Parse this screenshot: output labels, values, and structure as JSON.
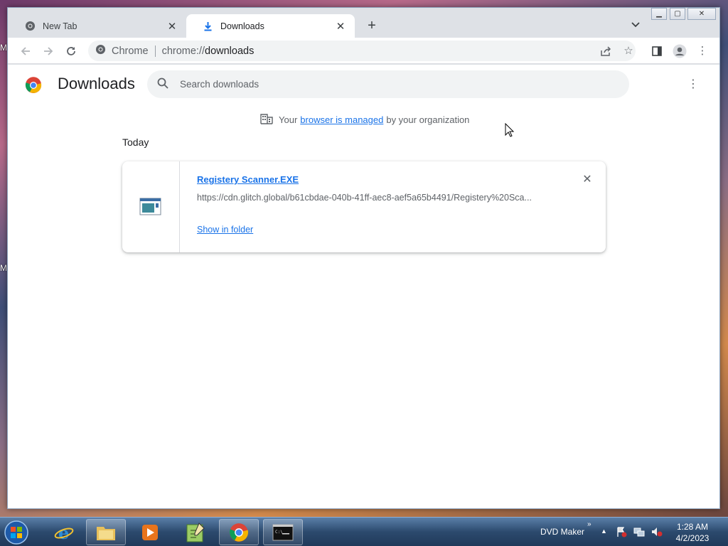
{
  "desktop": {
    "edge_labels": [
      "M",
      "M"
    ]
  },
  "browser": {
    "tabs": [
      {
        "label": "New Tab",
        "active": false
      },
      {
        "label": "Downloads",
        "active": true
      }
    ],
    "new_tab_symbol": "+",
    "close_symbol": "✕",
    "window_controls": {
      "minimize": "▁",
      "maximize": "▢",
      "close": "✕"
    },
    "omnibox": {
      "chip_label": "Chrome",
      "url_scheme": "chrome://",
      "url_host": "downloads"
    }
  },
  "page": {
    "title": "Downloads",
    "search_placeholder": "Search downloads",
    "managed_notice": {
      "prefix": "Your",
      "link": "browser is managed",
      "suffix": "by your organization"
    },
    "section_label": "Today",
    "downloads": [
      {
        "file_name": "Registery Scanner.EXE",
        "url": "https://cdn.glitch.global/b61cbdae-040b-41ff-aec8-aef5a65b4491/Registery%20Sca...",
        "action": "Show in folder",
        "icon": "executable-file-icon"
      }
    ]
  },
  "taskbar": {
    "apps": [
      "internet-explorer-icon",
      "file-explorer-icon",
      "media-player-icon",
      "notepad-plus-icon",
      "chrome-icon",
      "command-prompt-icon"
    ],
    "tray_label": "DVD Maker",
    "chevron": "»",
    "show_hidden": "▲",
    "time": "1:28 AM",
    "date": "4/2/2023"
  },
  "colors": {
    "accent": "#1a73e8",
    "tab_strip": "#dee1e6",
    "taskbar": "#2c4a6e"
  }
}
